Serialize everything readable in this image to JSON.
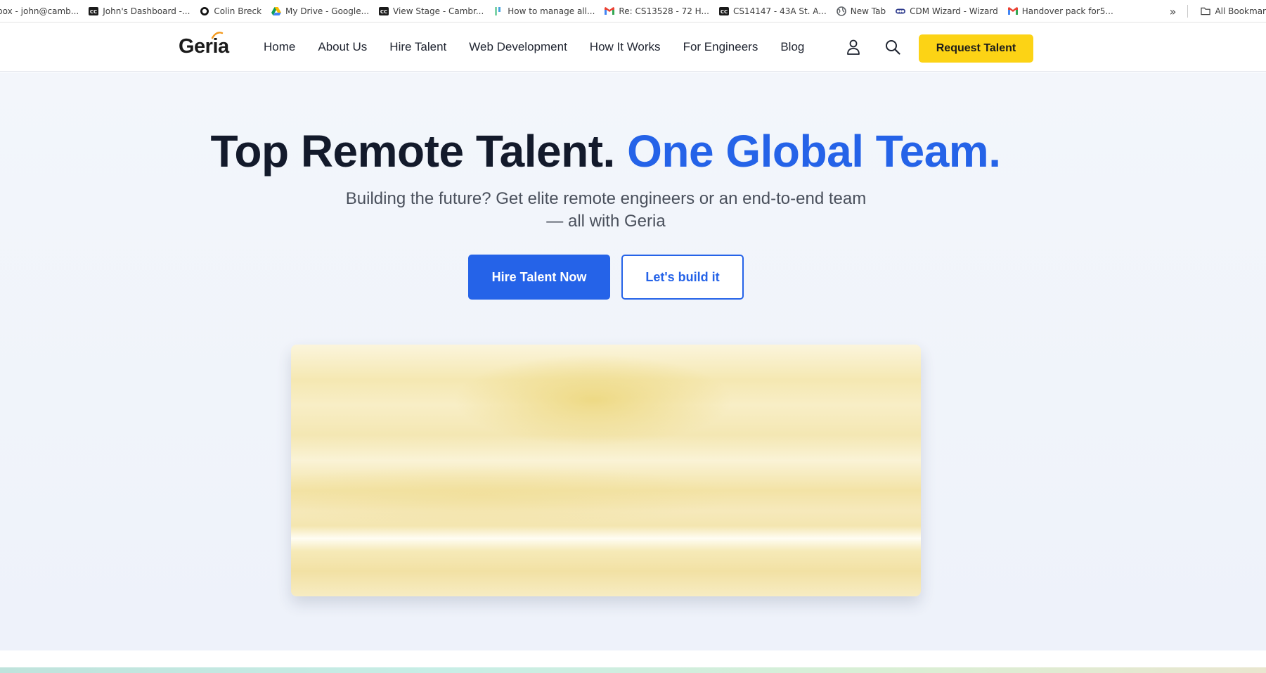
{
  "bookmarks": [
    {
      "label": "box - john@camb...",
      "icon": "gmail-icon"
    },
    {
      "label": "John's Dashboard -...",
      "icon": "cc-icon"
    },
    {
      "label": "Colin Breck",
      "icon": "circle-icon"
    },
    {
      "label": "My Drive - Google...",
      "icon": "google-drive-icon"
    },
    {
      "label": "View Stage - Cambr...",
      "icon": "cc-icon"
    },
    {
      "label": "How to manage all...",
      "icon": "bars-icon"
    },
    {
      "label": "Re: CS13528 - 72 H...",
      "icon": "gmail-icon"
    },
    {
      "label": "CS14147 - 43A St. A...",
      "icon": "cc-icon"
    },
    {
      "label": "New Tab",
      "icon": "globe-icon"
    },
    {
      "label": "CDM Wizard - Wizard",
      "icon": "cdm-icon"
    },
    {
      "label": "Handover pack for5...",
      "icon": "gmail-icon"
    }
  ],
  "bookmarks_overflow": "»",
  "all_bookmarks": "All Bookmar",
  "header": {
    "logo": "Geria",
    "nav": [
      "Home",
      "About Us",
      "Hire Talent",
      "Web Development",
      "How It Works",
      "For Engineers",
      "Blog"
    ],
    "cta": "Request Talent"
  },
  "hero": {
    "title_main": "Top Remote Talent. ",
    "title_accent": "One Global Team.",
    "subtitle": "Building the future? Get elite remote engineers or an end-to-end team — all with Geria",
    "primary_button": "Hire Talent Now",
    "secondary_button": "Let's build it"
  },
  "colors": {
    "accent_blue": "#2563e8",
    "cta_yellow": "#fcd315",
    "heading_dark": "#131a2b"
  }
}
